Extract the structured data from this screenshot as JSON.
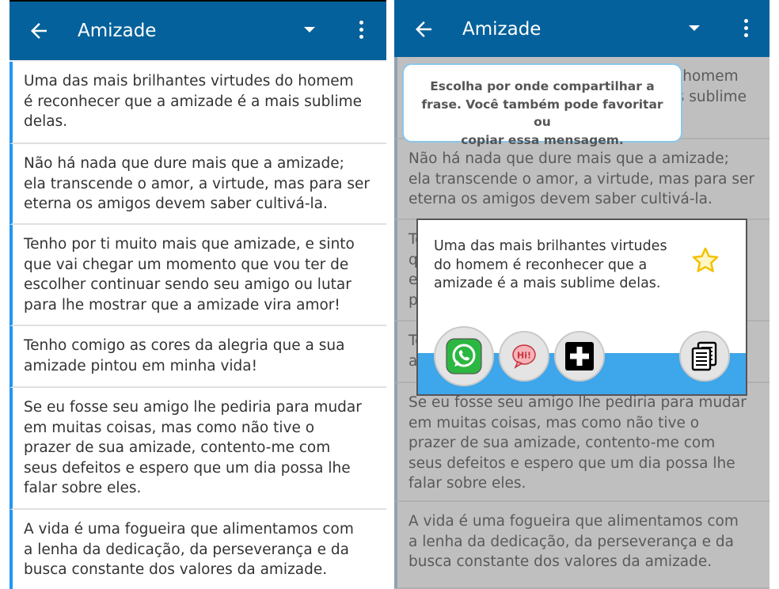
{
  "app": {
    "title": "Amizade"
  },
  "phrases": [
    "Uma das mais brilhantes virtudes do homem\né reconhecer que a amizade é a mais sublime\ndelas.",
    "Não há nada que dure mais que a amizade;\nela transcende o amor, a virtude, mas para ser\neterna os amigos devem saber cultivá-la.",
    "Tenho por ti muito mais que amizade, e sinto\nque vai chegar um momento que vou ter de\nescolher continuar sendo seu amigo ou lutar\npara lhe mostrar que a amizade vira amor!",
    "Tenho comigo as cores da alegria que a sua\namizade pintou em minha vida!",
    "Se eu fosse seu amigo lhe pediria para mudar\nem muitas coisas, mas como não tive o\nprazer de sua amizade, contento-me com\nseus defeitos e espero que um dia possa lhe\nfalar sobre eles.",
    "A vida é uma fogueira que alimentamos com\na lenha da dedicação, da perseverança e da\nbusca constante dos valores da amizade."
  ],
  "right_fragments": {
    "partial_line_1": "hoмем",
    "partial_line_2": "sublime",
    "item3_frag": "T",
    "item2_frag_a": "T",
    "item2_frag_b": "q",
    "item2_frag_c": "e",
    "item2_frag_d": "p"
  },
  "tooltip": {
    "text": "Escolha por onde compartilhar a\nfrase. Você também pode favoritar ou\ncopiar essa mensagem."
  },
  "share_dialog": {
    "message": "Uma das mais brilhantes virtudes\ndo homem é reconhecer que a\namizade é a mais sublime delas.",
    "hi_label": "Hi!",
    "icons": [
      "whatsapp-icon",
      "hi-chat-icon",
      "plus-icon",
      "copy-icon"
    ],
    "star_color": "#f2c200",
    "band_color": "#3ea6ea"
  },
  "colors": {
    "appbar": "#05619b",
    "accent": "#2196f3"
  }
}
